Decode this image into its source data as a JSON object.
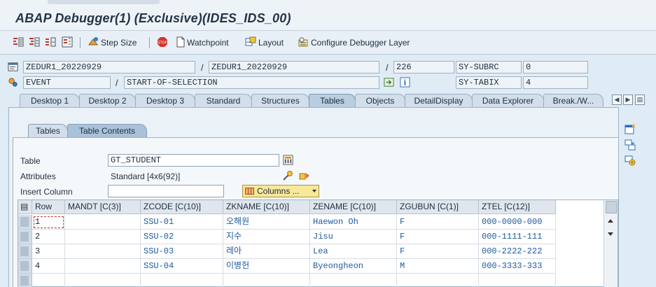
{
  "window": {
    "title": "ABAP Debugger(1)  (Exclusive)(IDES_IDS_00)"
  },
  "toolbar": {
    "step_size_label": "Step Size",
    "watchpoint_label": "Watchpoint",
    "layout_label": "Layout",
    "configure_label": "Configure Debugger Layer"
  },
  "info": {
    "program": "ZEDUR1_20220929",
    "include": "ZEDUR1_20220929",
    "line": "226",
    "subrc_label": "SY-SUBRC",
    "subrc_value": "0",
    "event_type": "EVENT",
    "event_name": "START-OF-SELECTION",
    "tabix_label": "SY-TABIX",
    "tabix_value": "4"
  },
  "tabs": [
    "Desktop 1",
    "Desktop 2",
    "Desktop 3",
    "Standard",
    "Structures",
    "Tables",
    "Objects",
    "DetailDisplay",
    "Data Explorer",
    "Break./W..."
  ],
  "active_tab": "Tables",
  "subtabs": [
    "Tables",
    "Table Contents"
  ],
  "active_subtab": "Table Contents",
  "form": {
    "table_label": "Table",
    "table_value": "GT_STUDENT",
    "attributes_label": "Attributes",
    "attributes_value": "Standard [4x6(92)]",
    "insert_column_label": "Insert Column",
    "insert_column_value": "",
    "columns_button": "Columns ..."
  },
  "grid": {
    "headers": [
      "Row",
      "MANDT [C(3)]",
      "ZCODE [C(10)]",
      "ZKNAME [C(10)]",
      "ZENAME [C(10)]",
      "ZGUBUN [C(1)]",
      "ZTEL [C(12)]"
    ],
    "rows": [
      [
        "1",
        "",
        "SSU-01",
        "오해원",
        "Haewon Oh",
        "F",
        "000-0000-000"
      ],
      [
        "2",
        "",
        "SSU-02",
        "지수",
        "Jisu",
        "F",
        "000-1111-111"
      ],
      [
        "3",
        "",
        "SSU-03",
        "레아",
        "Lea",
        "F",
        "000-2222-222"
      ],
      [
        "4",
        "",
        "SSU-04",
        "이병헌",
        "Byeongheon",
        "M",
        "000-3333-333"
      ]
    ]
  }
}
